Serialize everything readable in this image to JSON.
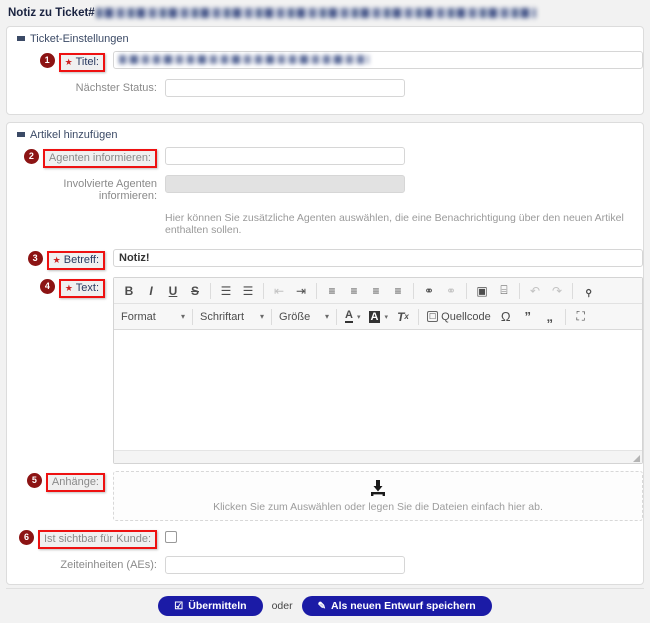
{
  "page": {
    "title_prefix": "Notiz zu Ticket#",
    "title_redacted_placeholder": "20250804 63002066 Anmeldungen — Ihre Prüfcode für Office 365 Education lautet 349126."
  },
  "sections": {
    "ticket_settings": {
      "header": "Ticket-Einstellungen",
      "caret": "caret-down-icon",
      "fields": {
        "titel": {
          "badge": "1",
          "label": "Titel:",
          "required_marker": "★",
          "value": "Ihre Prüfcode für Office 365 Education lautet 349126",
          "placeholder": ""
        },
        "naechster_status": {
          "label": "Nächster Status:",
          "value": "",
          "placeholder": ""
        }
      }
    },
    "add_article": {
      "header": "Artikel hinzufügen",
      "caret": "caret-down-icon",
      "fields": {
        "agenten_informieren": {
          "badge": "2",
          "label": "Agenten informieren:",
          "value": "",
          "placeholder": ""
        },
        "involvierte_agenten": {
          "label": "Involvierte Agenten informieren:",
          "value": "",
          "placeholder": "",
          "disabled": true
        },
        "hint": "Hier können Sie zusätzliche Agenten auswählen, die eine Benachrichtigung über den neuen Artikel enthalten sollen.",
        "betreff": {
          "badge": "3",
          "label": "Betreff:",
          "required_marker": "★",
          "value": "Notiz!",
          "placeholder": ""
        },
        "text": {
          "badge": "4",
          "label": "Text:",
          "required_marker": "★",
          "value": ""
        },
        "anhaenge": {
          "badge": "5",
          "label": "Anhänge:",
          "dropzone_text": "Klicken Sie zum Auswählen oder legen Sie die Dateien einfach hier ab.",
          "dropzone_icon": "download-icon"
        },
        "sichtbar_fuer_kunde": {
          "badge": "6",
          "label": "Ist sichtbar für Kunde:",
          "checked": false
        },
        "zeiteinheiten": {
          "label": "Zeiteinheiten (AEs):",
          "value": "",
          "placeholder": ""
        }
      }
    }
  },
  "editor": {
    "toolbar_row1": [
      {
        "icon": "bold-icon",
        "glyph": "B",
        "dim": false
      },
      {
        "icon": "italic-icon",
        "glyph": "I",
        "dim": false
      },
      {
        "icon": "underline-icon",
        "glyph": "U",
        "dim": false
      },
      {
        "icon": "strikethrough-icon",
        "glyph": "S",
        "dim": false
      },
      {
        "sep": true
      },
      {
        "icon": "numbered-list-icon",
        "glyph": "☷",
        "dim": false
      },
      {
        "icon": "bulleted-list-icon",
        "glyph": "☷",
        "dim": false
      },
      {
        "sep": true
      },
      {
        "icon": "decrease-indent-icon",
        "glyph": "⬅",
        "dim": true
      },
      {
        "icon": "increase-indent-icon",
        "glyph": "➡",
        "dim": false
      },
      {
        "sep": true
      },
      {
        "icon": "align-left-icon",
        "glyph": "≡",
        "dim": false
      },
      {
        "icon": "align-center-icon",
        "glyph": "≡",
        "dim": false
      },
      {
        "icon": "align-right-icon",
        "glyph": "≡",
        "dim": false
      },
      {
        "icon": "align-justify-icon",
        "glyph": "≡",
        "dim": false
      },
      {
        "sep": true
      },
      {
        "icon": "link-icon",
        "glyph": "⚭",
        "dim": false
      },
      {
        "icon": "unlink-icon",
        "glyph": "⚭",
        "dim": true
      },
      {
        "sep": true
      },
      {
        "icon": "image-icon",
        "glyph": "Ὓb",
        "dim": false
      },
      {
        "icon": "table-icon",
        "glyph": "⌸",
        "dim": false
      },
      {
        "sep": true
      },
      {
        "icon": "undo-icon",
        "glyph": "↶",
        "dim": true
      },
      {
        "icon": "redo-icon",
        "glyph": "↷",
        "dim": true
      },
      {
        "sep": true
      },
      {
        "icon": "search-icon",
        "glyph": "🔍",
        "dim": false
      }
    ],
    "toolbar_row2": {
      "format_label": "Format",
      "font_label": "Schriftart",
      "size_label": "Größe",
      "text_color_icon": "text-color-icon",
      "bg_color_icon": "background-color-icon",
      "remove_format_icon": "remove-format-icon",
      "source_label": "Quellcode",
      "source_icon": "source-code-icon",
      "special_char_icon": "omega-icon",
      "quote_open_icon": "quote-open-icon",
      "quote_close_icon": "quote-close-icon",
      "maximize_icon": "maximize-icon"
    },
    "content": "",
    "resize_handle_icon": "resize-handle-icon"
  },
  "footer": {
    "submit_label": "Übermitteln",
    "submit_icon": "check-square-icon",
    "separator": "oder",
    "draft_label": "Als neuen Entwurf speichern",
    "draft_icon": "edit-square-icon"
  },
  "colors": {
    "accent_button": "#1b1ba6",
    "badge": "#8c1414",
    "highlight_box": "#ee1111",
    "label_strong": "#2a3a60",
    "label_muted": "#8a8a8a",
    "page_background": "#f2f2f2"
  }
}
